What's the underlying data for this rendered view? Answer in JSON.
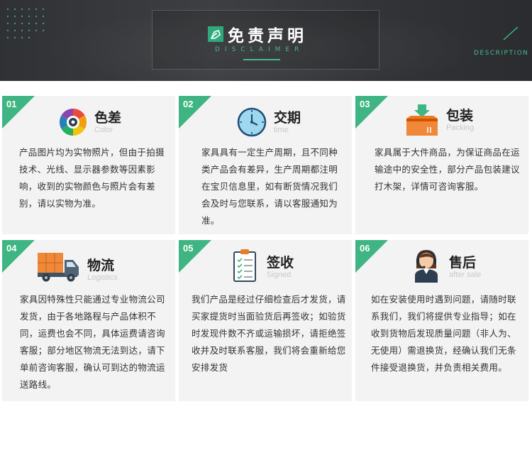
{
  "header": {
    "title": "免责声明",
    "subtitle": "DISCLAIMER",
    "side_label": "DESCRIPTION"
  },
  "cards": [
    {
      "num": "01",
      "title": "色差",
      "subtitle": "Color",
      "icon": "color-wheel-icon",
      "body": "产品图片均为实物照片，但由于拍摄技术、光线、显示器参数等因素影响，收到的实物颜色与照片会有差别，请以实物为准。"
    },
    {
      "num": "02",
      "title": "交期",
      "subtitle": "time",
      "icon": "clock-icon",
      "body": "家具具有一定生产周期，且不同种类产品会有差异，生产周期都注明在宝贝信息里，如有断货情况我们会及时与您联系，请以客服通知为准。"
    },
    {
      "num": "03",
      "title": "包装",
      "subtitle": "Packing",
      "icon": "package-icon",
      "body": "家具属于大件商品，为保证商品在运输途中的安全性，部分产品包装建议打木架，详情可咨询客服。"
    },
    {
      "num": "04",
      "title": "物流",
      "subtitle": "Logistics",
      "icon": "truck-icon",
      "body": "家具因特殊性只能通过专业物流公司发货，由于各地路程与产品体积不同，运费也会不同，具体运费请咨询客服；部分地区物流无法到达，请下单前咨询客服，确认可到达的物流运送路线。"
    },
    {
      "num": "05",
      "title": "签收",
      "subtitle": "Signed",
      "icon": "clipboard-icon",
      "body": "我们产品是经过仔细检查后才发货，请买家提货时当面验货后再签收；如验货时发现件数不齐或运输损坏，请拒绝签收并及时联系客服，我们将会重新给您安排发货"
    },
    {
      "num": "06",
      "title": "售后",
      "subtitle": "after sale",
      "icon": "headset-agent-icon",
      "body": "如在安装使用时遇到问题，请随时联系我们，我们将提供专业指导；如在收到货物后发现质量问题（非人为、无使用）需退换货，经确认我们无条件接受退换货，并负责相关费用。"
    }
  ],
  "colors": {
    "accent": "#3fb583",
    "banner": "#333538",
    "card": "#f3f3f3"
  }
}
